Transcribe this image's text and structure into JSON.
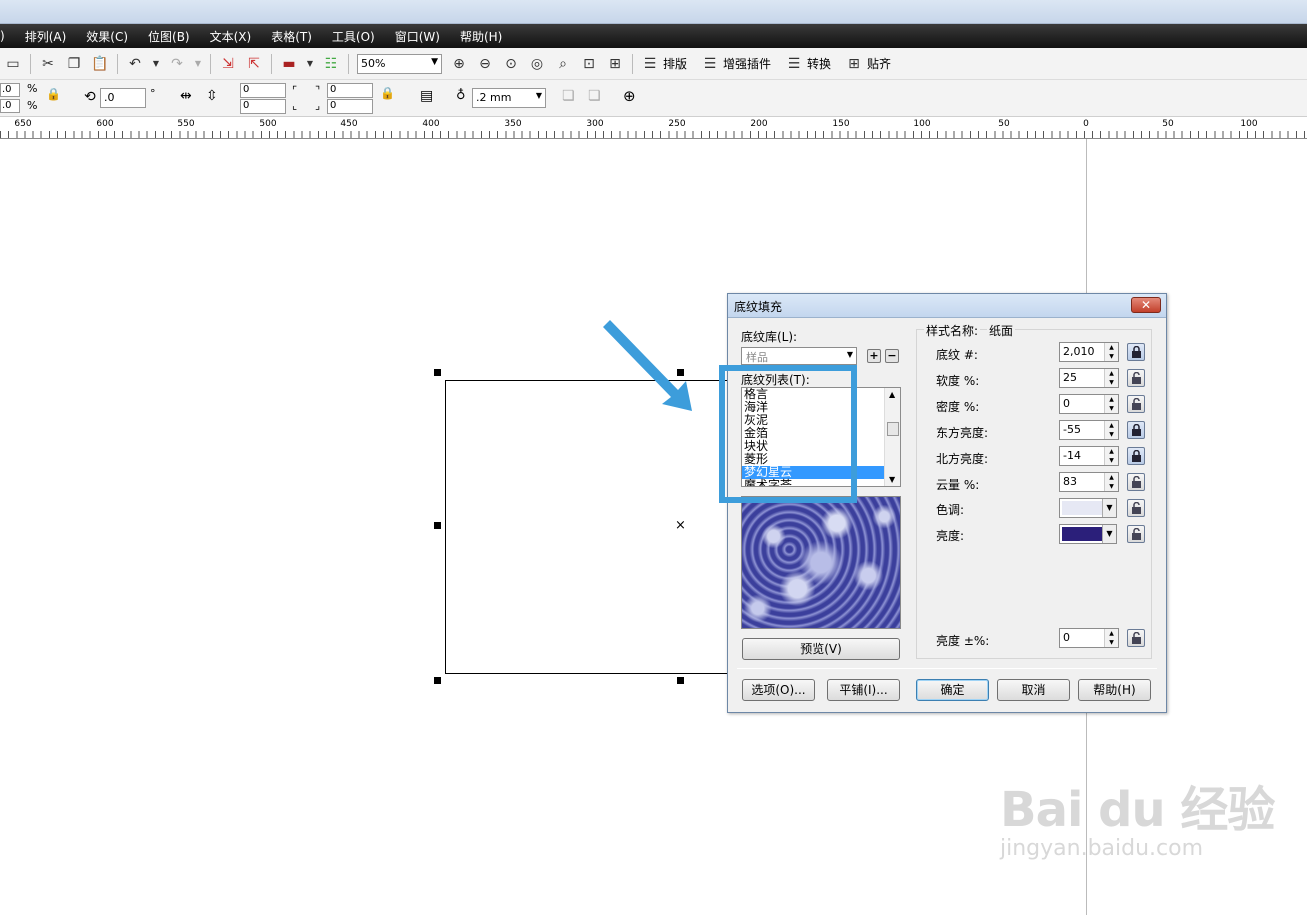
{
  "menubar": {
    "items": [
      "排列(A)",
      "效果(C)",
      "位图(B)",
      "文本(X)",
      "表格(T)",
      "工具(O)",
      "窗口(W)",
      "帮助(H)"
    ],
    "leading": ")"
  },
  "toolbar1": {
    "zoom": "50%",
    "buttons": [
      "排版",
      "增强插件",
      "转换",
      "贴齐"
    ]
  },
  "toolbar2": {
    "pct1": ".0",
    "pct2": ".0",
    "pct_sign": "%",
    "rotation": ".0",
    "degree": "°",
    "x1": "0",
    "x2": "0",
    "y1": "0",
    "y2": "0",
    "outline": ".2 mm"
  },
  "ruler": {
    "labels": [
      "650",
      "600",
      "550",
      "500",
      "450",
      "400",
      "350",
      "300",
      "250",
      "200",
      "150",
      "100",
      "50",
      "0",
      "50",
      "100"
    ]
  },
  "dialog": {
    "title": "底纹填充",
    "library_label": "底纹库(L):",
    "library_value": "样品",
    "list_label": "底纹列表(T):",
    "list_items": [
      "格言",
      "海洋",
      "灰泥",
      "金箔",
      "块状",
      "菱形",
      "梦幻星云",
      "魔术字荟"
    ],
    "selected_index": 6,
    "preview_button": "预览(V)",
    "style_label": "样式名称:",
    "style_name": "纸面",
    "params": [
      {
        "label": "底纹 #:",
        "value": "2,010",
        "locked": true
      },
      {
        "label": "软度 %:",
        "value": "25",
        "locked": false
      },
      {
        "label": "密度 %:",
        "value": "0",
        "locked": false
      },
      {
        "label": "东方亮度:",
        "value": "-55",
        "locked": true
      },
      {
        "label": "北方亮度:",
        "value": "-14",
        "locked": true
      },
      {
        "label": "云量 %:",
        "value": "83",
        "locked": false
      }
    ],
    "hue_label": "色调:",
    "hue_color": "#e6e8f4",
    "brightness_label": "亮度:",
    "brightness_color": "#2b1f7a",
    "brightness_pm_label": "亮度 ±%:",
    "brightness_pm_value": "0",
    "buttons": {
      "options": "选项(O)...",
      "tile": "平铺(I)...",
      "ok": "确定",
      "cancel": "取消",
      "help": "帮助(H)"
    }
  },
  "watermark": {
    "brand": "Bai du 经验",
    "url": "jingyan.baidu.com"
  },
  "colors": {
    "highlight": "#3d9ddb",
    "selection": "#3399ff"
  }
}
